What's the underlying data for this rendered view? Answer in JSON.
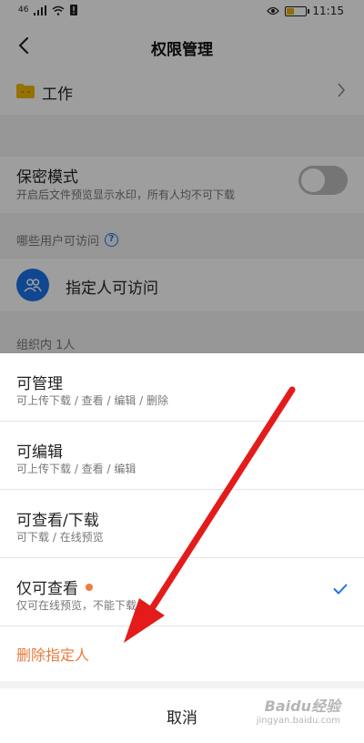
{
  "statusbar": {
    "signal": "46",
    "time": "11:15"
  },
  "header": {
    "title": "权限管理"
  },
  "folder": {
    "name": "工作"
  },
  "secret_mode": {
    "title": "保密模式",
    "desc": "开启后文件预览显示水印，所有人均不可下载",
    "enabled": false
  },
  "access": {
    "label": "哪些用户可访问",
    "help": "?",
    "option": "指定人可访问"
  },
  "org": {
    "label": "组织内 1人"
  },
  "sheet": {
    "options": [
      {
        "title": "可管理",
        "desc": "可上传下载 / 查看 / 编辑 / 删除"
      },
      {
        "title": "可编辑",
        "desc": "可上传下载 / 查看 / 编辑"
      },
      {
        "title": "可查看/下载",
        "desc": "可下载 / 在线预览"
      },
      {
        "title": "仅可查看",
        "desc": "仅可在线预览，不能下载",
        "selected": true
      }
    ],
    "delete": "删除指定人",
    "cancel": "取消"
  },
  "watermark": {
    "main": "Baidu经验",
    "sub": "jingyan.baidu.com"
  },
  "colors": {
    "accent": "#1a73e8",
    "danger": "#e87a3d",
    "arrow": "#e41b1b"
  }
}
